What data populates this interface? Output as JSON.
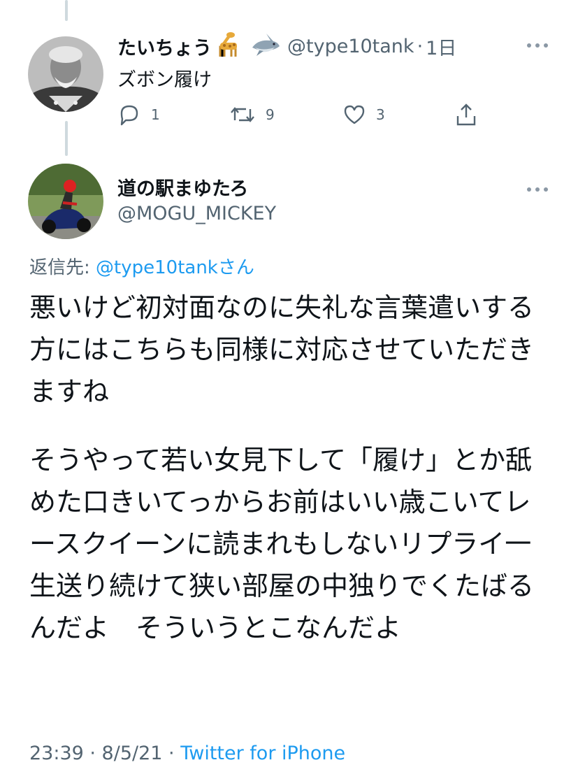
{
  "reply_tweet": {
    "display_name": "たいちょう",
    "name_emojis": [
      "giraffe-icon",
      "shark-icon"
    ],
    "handle": "@type10tank",
    "separator": "·",
    "time": "1日",
    "text": "ズボン履け",
    "more_icon": "more-icon",
    "actions": {
      "reply_count": "1",
      "retweet_count": "9",
      "like_count": "3"
    }
  },
  "main_tweet": {
    "display_name": "道の駅まゆたろ",
    "handle": "@MOGU_MICKEY",
    "more_icon": "more-icon",
    "replying_label": "返信先: ",
    "replying_to": "@type10tankさん",
    "paragraphs": [
      "悪いけど初対面なのに失礼な言葉遣いする方にはこちらも同様に対応させていただきますね",
      "そうやって若い女見下して「履け」とか舐めた口きいてっからお前はいい歳こいてレースクイーンに読まれもしないリプライ一生送り続けて狭い部屋の中独りでくたばるんだよ　そういうとこなんだよ"
    ],
    "timestamp": "23:39 · 8/5/21 · ",
    "source": "Twitter for iPhone"
  },
  "colors": {
    "text": "#0f1419",
    "secondary": "#536471",
    "link": "#1d9bf0",
    "thread_line": "#cfd9de"
  }
}
